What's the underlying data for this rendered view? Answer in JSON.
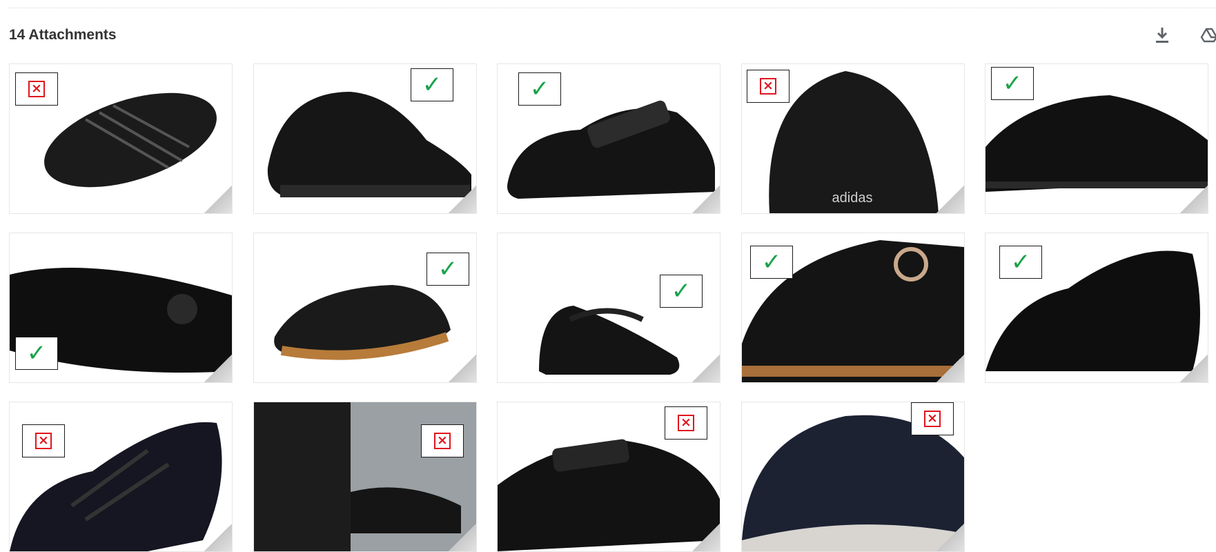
{
  "header": {
    "attachments_label": "14 Attachments",
    "download_icon": "download-icon",
    "drive_icon": "save-to-drive-icon"
  },
  "colors": {
    "accepted": "#19a34a",
    "rejected": "#e0141e",
    "shoe": "#141414"
  },
  "attachments": [
    {
      "status": "rejected",
      "subject": "black lace-up shoe top view"
    },
    {
      "status": "accepted",
      "subject": "black slip-on leather shoe"
    },
    {
      "status": "accepted",
      "subject": "black velcro strap school shoe"
    },
    {
      "status": "rejected",
      "subject": "black adidas sneaker heel"
    },
    {
      "status": "accepted",
      "subject": "black brogue oxford shoe"
    },
    {
      "status": "accepted",
      "subject": "black patent loafer with tassels"
    },
    {
      "status": "accepted",
      "subject": "black moccasin with gum sole"
    },
    {
      "status": "accepted",
      "subject": "black mary jane shoe"
    },
    {
      "status": "accepted",
      "subject": "black t-bar mary jane with buckle"
    },
    {
      "status": "accepted",
      "subject": "black derby lace-up shoe"
    },
    {
      "status": "rejected",
      "subject": "black athletic trainer"
    },
    {
      "status": "rejected",
      "subject": "person wearing black sneakers"
    },
    {
      "status": "rejected",
      "subject": "black double velcro shoe"
    },
    {
      "status": "rejected",
      "subject": "navy skechers knit sneaker"
    }
  ]
}
